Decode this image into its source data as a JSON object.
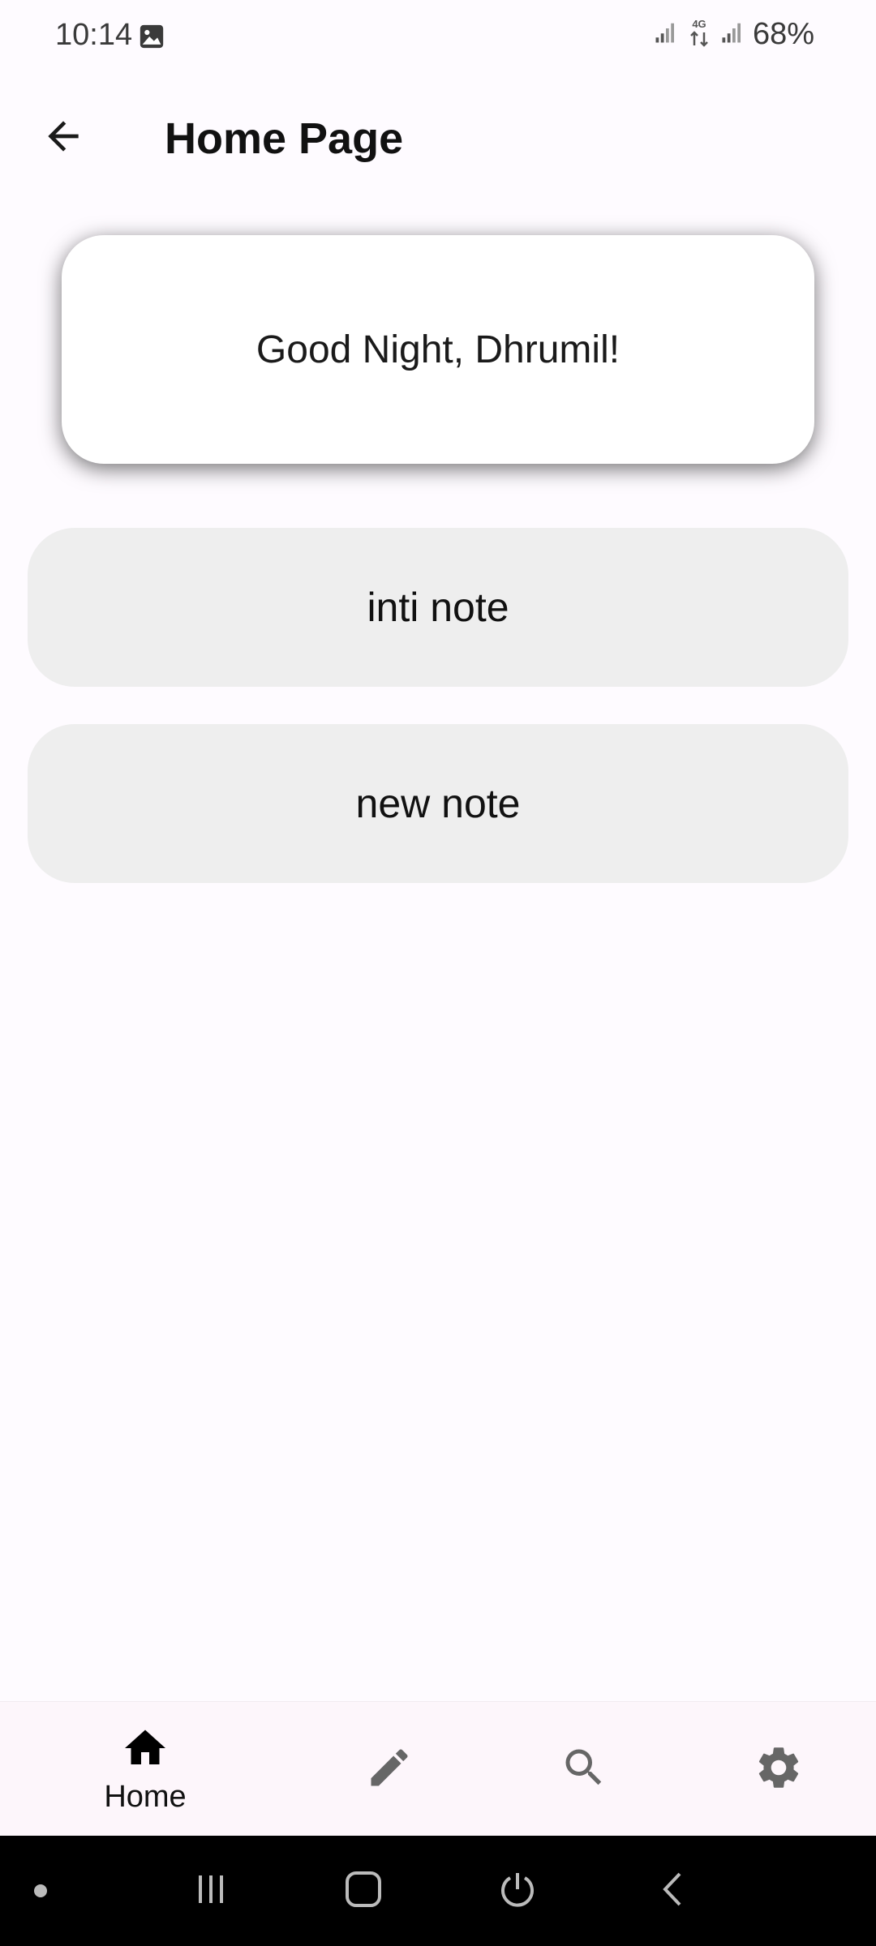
{
  "status_bar": {
    "time": "10:14",
    "network": "4G",
    "battery": "68%",
    "icons": [
      "gallery-icon",
      "signal-icon",
      "network-4g-icon",
      "signal-icon"
    ]
  },
  "app_bar": {
    "title": "Home Page",
    "back_icon": "arrow-back-icon"
  },
  "greeting": {
    "text": "Good Night, Dhrumil!"
  },
  "notes": [
    {
      "title": "inti note"
    },
    {
      "title": "new note"
    }
  ],
  "bottom_nav": {
    "items": [
      {
        "label": "Home",
        "icon": "home-icon",
        "active": true
      },
      {
        "label": "",
        "icon": "edit-icon",
        "active": false
      },
      {
        "label": "",
        "icon": "search-icon",
        "active": false
      },
      {
        "label": "",
        "icon": "settings-icon",
        "active": false
      }
    ]
  },
  "system_nav": {
    "icons": [
      "dot-icon",
      "recent-apps-icon",
      "home-button-icon",
      "power-icon",
      "back-icon"
    ]
  },
  "colors": {
    "background": "#fefbff",
    "card": "#ffffff",
    "note_item": "#eeeeee",
    "nav_background": "#fdf6fb",
    "active_icon": "#000000",
    "inactive_icon": "#666666",
    "system_nav": "#000000"
  }
}
